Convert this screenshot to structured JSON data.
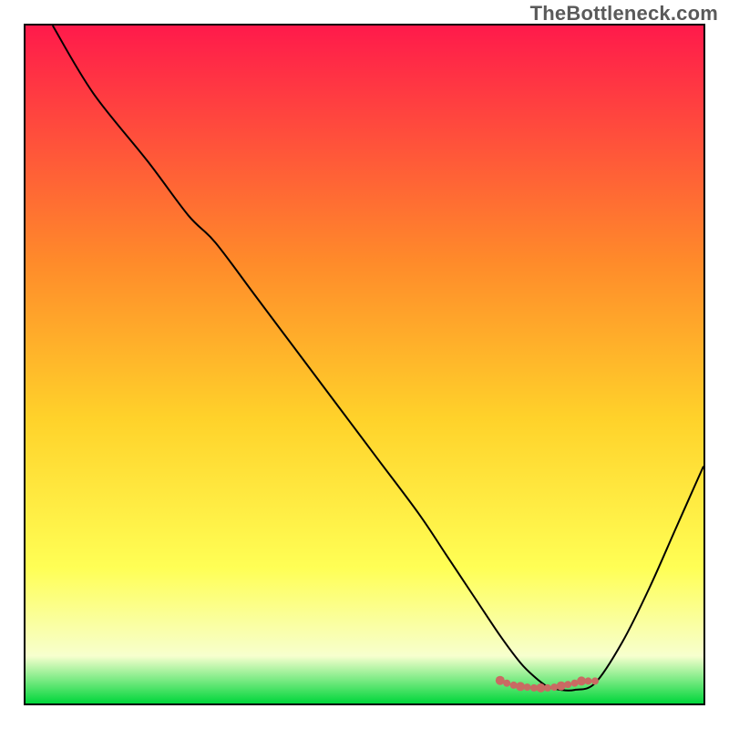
{
  "watermark": "TheBottleneck.com",
  "chart_data": {
    "type": "line",
    "title": "",
    "xlabel": "",
    "ylabel": "",
    "xlim": [
      0,
      100
    ],
    "ylim": [
      0,
      100
    ],
    "grid": false,
    "legend_position": "none",
    "gradient": {
      "top": "#ff1a4b",
      "mid_upper": "#ff8b2a",
      "mid": "#ffd22a",
      "mid_lower": "#ffff55",
      "lower": "#f7ffce",
      "bottom": "#00d63a"
    },
    "series": [
      {
        "name": "bottleneck-curve",
        "color": "#000000",
        "x": [
          4,
          10,
          18,
          24,
          28,
          34,
          40,
          46,
          52,
          58,
          62,
          66,
          70,
          73,
          75,
          77,
          79,
          81,
          84,
          88,
          92,
          96,
          100
        ],
        "y": [
          100,
          90,
          80,
          72,
          68,
          60,
          52,
          44,
          36,
          28,
          22,
          16,
          10,
          6,
          4,
          2.5,
          2,
          2,
          3,
          9,
          17,
          26,
          35
        ]
      },
      {
        "name": "marker-band",
        "color": "#c96a63",
        "x": [
          70,
          71,
          72,
          73,
          74,
          75,
          76,
          77,
          78,
          79,
          80,
          81,
          82,
          83,
          84
        ],
        "y": [
          3.4,
          3.0,
          2.7,
          2.5,
          2.4,
          2.3,
          2.3,
          2.3,
          2.4,
          2.6,
          2.8,
          3.0,
          3.3,
          3.3,
          3.3
        ]
      }
    ],
    "annotations": []
  }
}
